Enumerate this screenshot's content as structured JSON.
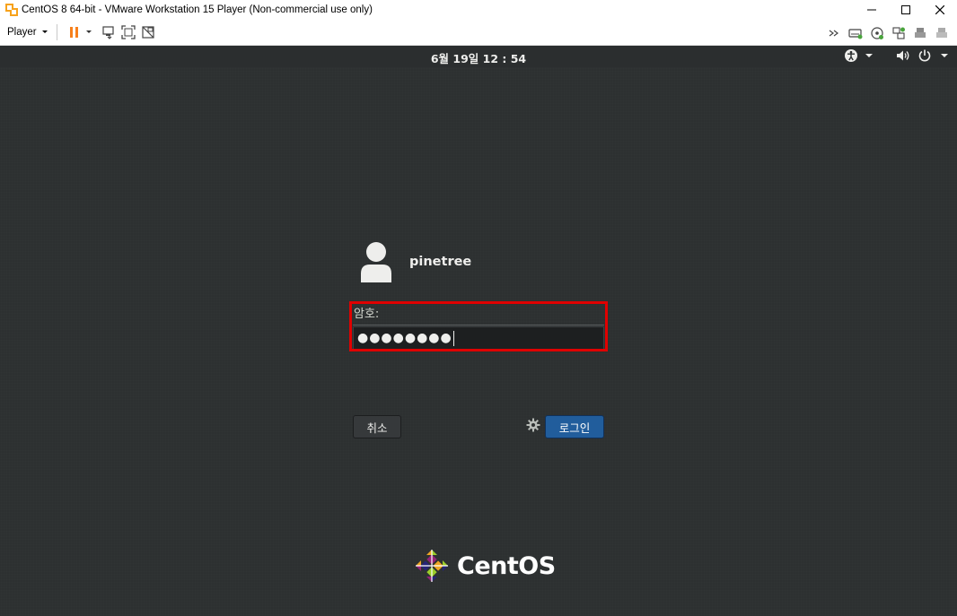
{
  "window": {
    "title": "CentOS 8 64-bit - VMware Workstation 15 Player (Non-commercial use only)",
    "icon": "vmware-player-icon",
    "controls": [
      "minimize-icon",
      "maximize-icon",
      "close-icon"
    ]
  },
  "toolbar": {
    "player_label": "Player",
    "left_icons": [
      "pause-icon",
      "send-ctrl-alt-del-icon",
      "fullscreen-icon",
      "unity-icon"
    ],
    "right_icons": [
      "more-devices-icon",
      "hard-disk-icon",
      "cd-dvd-icon",
      "network-icon",
      "printer-icon",
      "sound-card-icon"
    ]
  },
  "guest": {
    "clock": "6월 19일  12 : 54",
    "tray_icons": [
      "accessibility-icon",
      "volume-icon",
      "power-icon"
    ],
    "user": {
      "name": "pinetree"
    },
    "password": {
      "label": "암호:",
      "masked_value": "●●●●●●●●"
    },
    "buttons": {
      "cancel": "취소",
      "login": "로그인"
    },
    "logo_text": "CentOS",
    "colors": {
      "highlight": "#e00000",
      "login_button": "#215d9c",
      "background": "#2d3031"
    }
  }
}
